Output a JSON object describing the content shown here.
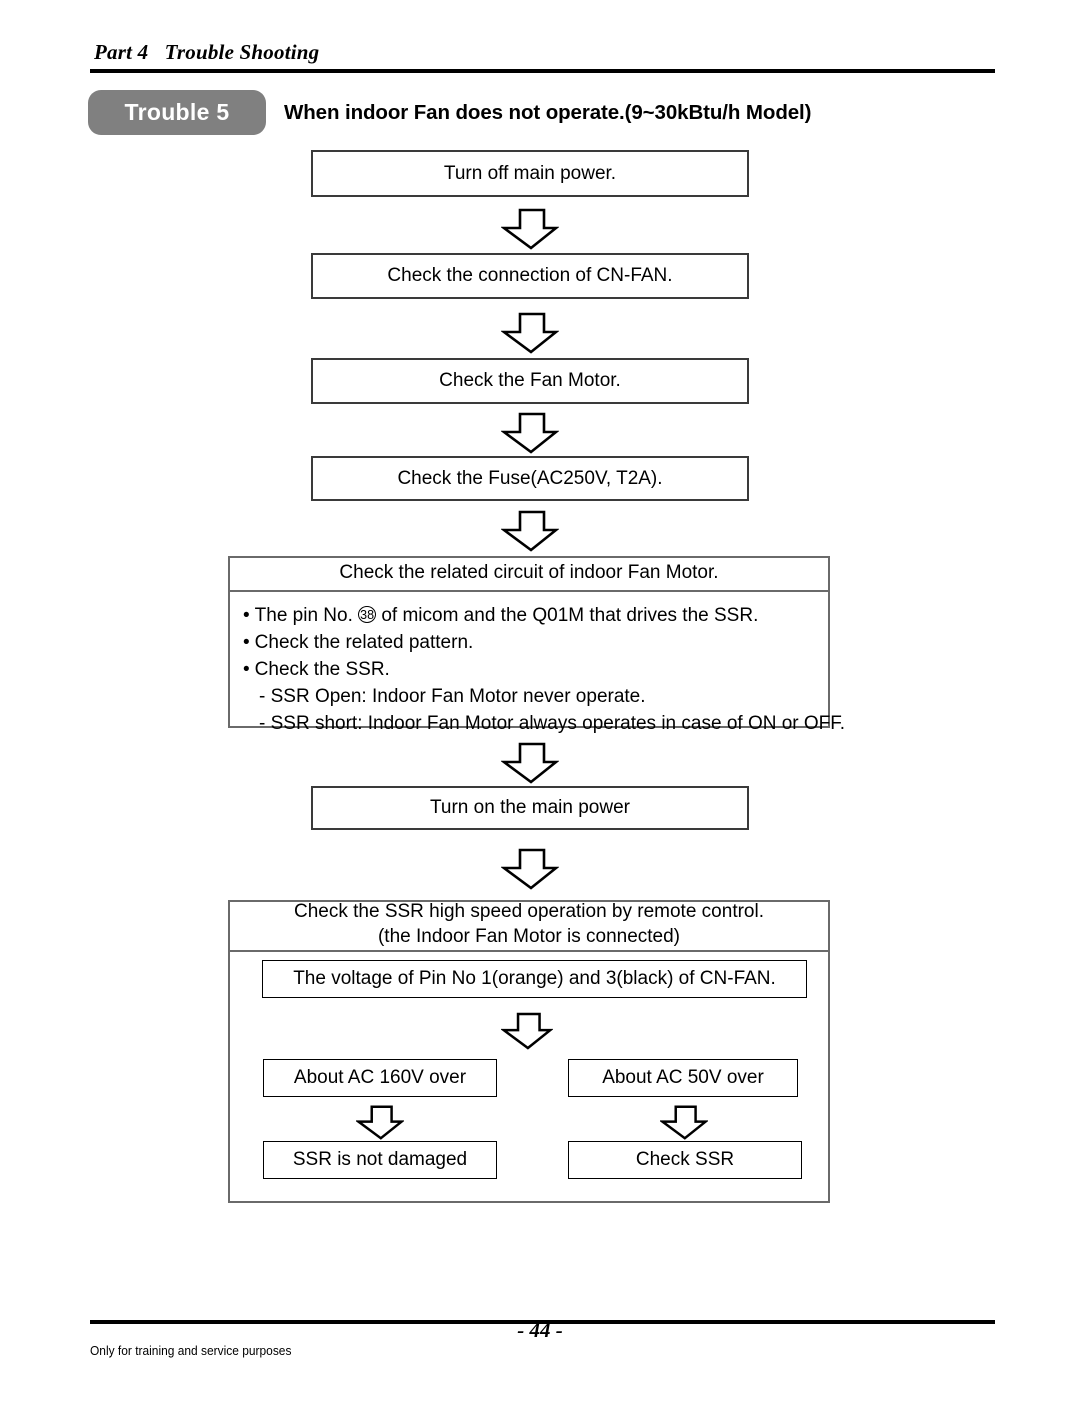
{
  "header": {
    "part_label": "Part 4   Trouble Shooting"
  },
  "banner": {
    "badge": "Trouble 5",
    "heading": "When indoor Fan does not operate.(9~30kBtu/h Model)",
    "badge_color": "#808080"
  },
  "flow": {
    "step1": "Turn off main power.",
    "step2": "Check the connection of CN-FAN.",
    "step3": "Check the Fan Motor.",
    "step4": "Check the Fuse(AC250V, T2A).",
    "detail_panel": {
      "title": "Check the related circuit of indoor Fan Motor.",
      "lines": {
        "l1_pre": "The pin No. ",
        "l1_circled": "38",
        "l1_post": " of micom and the Q01M that drives the SSR.",
        "l2": "Check the related pattern.",
        "l3": "Check the SSR.",
        "l4": "- SSR Open: Indoor Fan Motor never operate.",
        "l5": "- SSR short: Indoor Fan Motor always operates in case of ON or OFF."
      }
    },
    "step5": "Turn on the main power",
    "result_panel": {
      "title_line1": "Check the SSR high speed operation by remote control.",
      "title_line2": "(the Indoor Fan Motor is connected)",
      "voltage_box": "The voltage of Pin No 1(orange) and 3(black) of CN-FAN.",
      "branch_left_top": "About AC 160V over",
      "branch_right_top": "About AC 50V over",
      "branch_left_bottom": "SSR is not damaged",
      "branch_right_bottom": "Check SSR"
    }
  },
  "footer": {
    "note": "Only for training and service purposes",
    "page": "- 44 -"
  },
  "icons": {
    "down_arrow": "down-block-arrow"
  }
}
